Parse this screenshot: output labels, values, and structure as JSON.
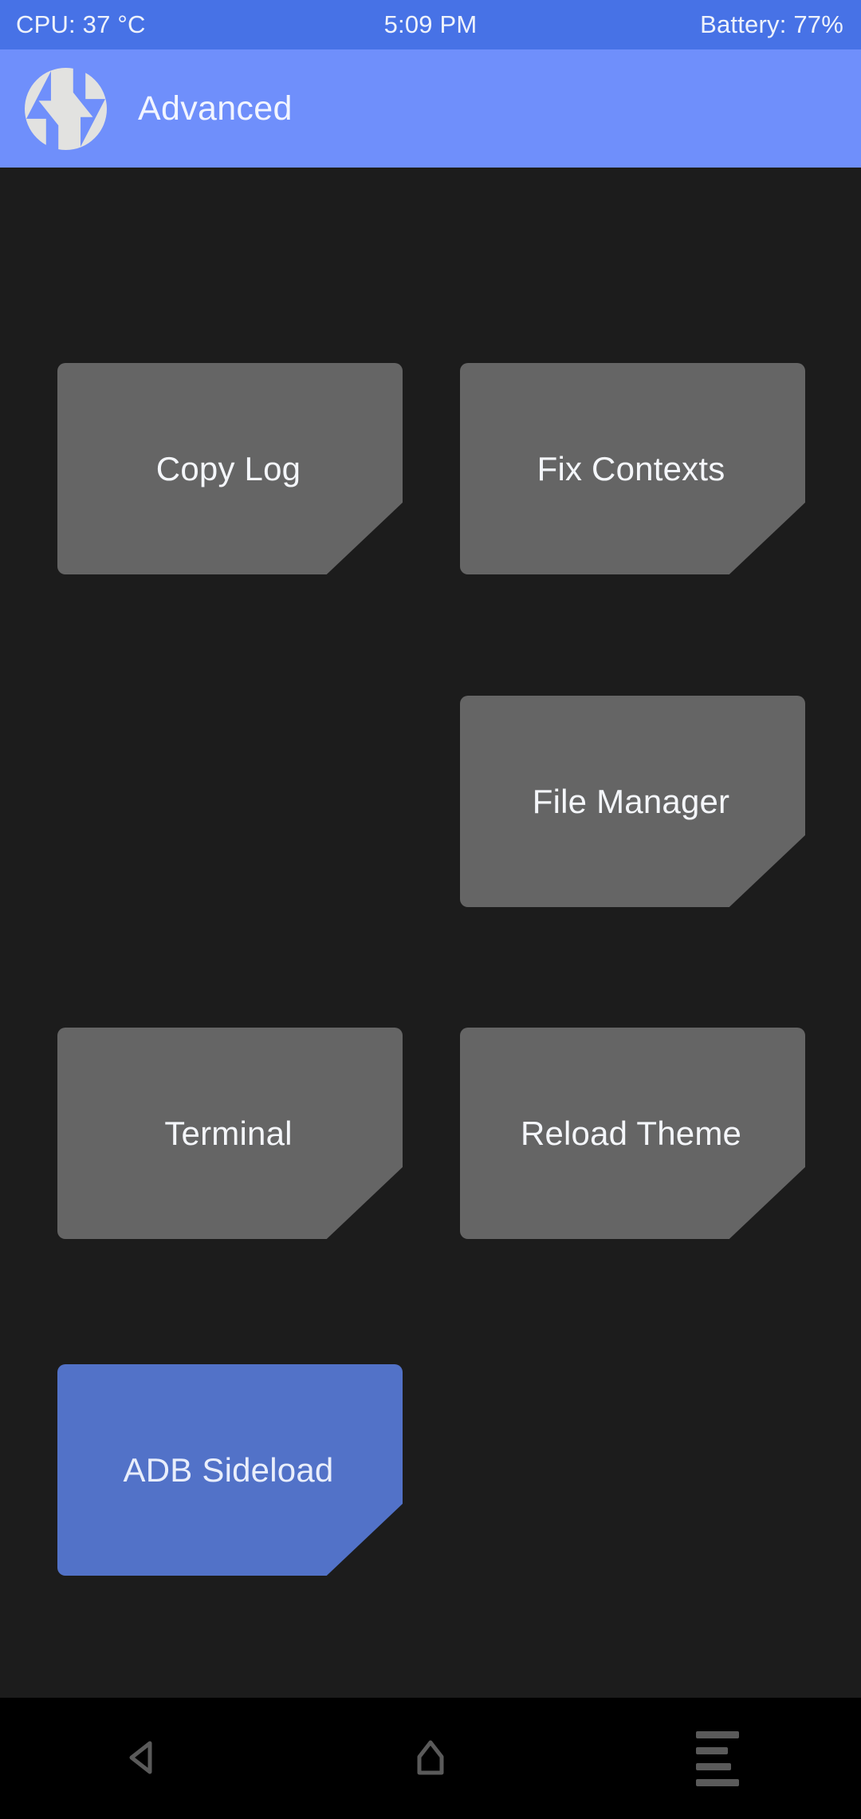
{
  "statusbar": {
    "cpu": "CPU: 37 °C",
    "time": "5:09 PM",
    "battery": "Battery: 77%"
  },
  "header": {
    "title": "Advanced",
    "logo_name": "twrp-logo-icon",
    "background": "#6f8ffb"
  },
  "theme": {
    "accent": "#5272c8",
    "button": "#656565",
    "background": "#1c1c1c",
    "statusbar": "#4772e6",
    "text": "#f4f6fa"
  },
  "main": {
    "buttons": [
      {
        "id": "copy-log",
        "label": "Copy Log",
        "column": "left",
        "row": 1,
        "accent": false
      },
      {
        "id": "fix-contexts",
        "label": "Fix Contexts",
        "column": "right",
        "row": 1,
        "accent": false
      },
      {
        "id": "file-manager",
        "label": "File Manager",
        "column": "right",
        "row": 2,
        "accent": false
      },
      {
        "id": "terminal",
        "label": "Terminal",
        "column": "left",
        "row": 3,
        "accent": false
      },
      {
        "id": "reload-theme",
        "label": "Reload Theme",
        "column": "right",
        "row": 3,
        "accent": false
      },
      {
        "id": "adb-sideload",
        "label": "ADB Sideload",
        "column": "left",
        "row": 4,
        "accent": true
      }
    ]
  },
  "navbar": {
    "items": [
      {
        "id": "back",
        "icon": "back-triangle-icon",
        "label": "Back"
      },
      {
        "id": "home",
        "icon": "home-icon",
        "label": "Home"
      },
      {
        "id": "recents",
        "icon": "recents-menu-icon",
        "label": "Recents"
      }
    ]
  }
}
